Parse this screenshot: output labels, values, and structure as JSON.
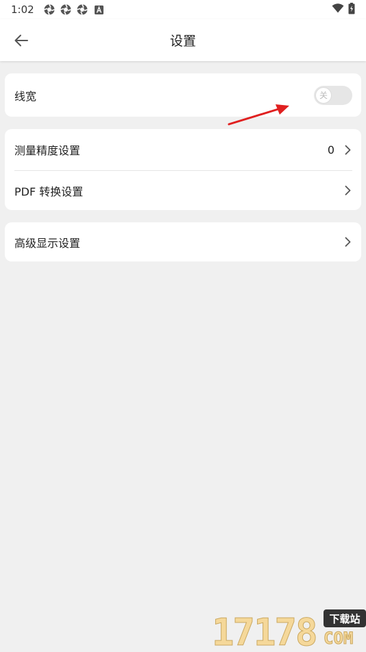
{
  "status_bar": {
    "time": "1:02",
    "icons": [
      "aperture-icon",
      "aperture-icon",
      "aperture-icon",
      "font-a-icon"
    ],
    "right_icons": [
      "wifi-icon",
      "battery-icon"
    ]
  },
  "app_bar": {
    "title": "设置",
    "back_icon": "arrow-left-icon"
  },
  "card1": {
    "line_width_label": "线宽",
    "toggle_text": "关",
    "toggle_on": false
  },
  "card2": {
    "precision_label": "测量精度设置",
    "precision_value": "0",
    "pdf_label": "PDF 转换设置"
  },
  "card3": {
    "advanced_label": "高级显示设置"
  },
  "watermark": {
    "number": "17178",
    "tag": "下载站",
    "domain": "COM"
  },
  "colors": {
    "background": "#f0f0f0",
    "card": "#ffffff",
    "annotation_arrow": "#e02020"
  }
}
